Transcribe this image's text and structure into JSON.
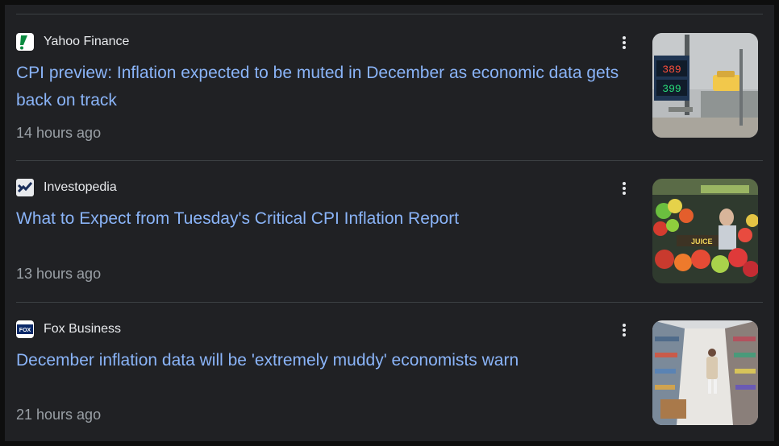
{
  "articles": [
    {
      "source": "Yahoo Finance",
      "favicon": "yahoo-finance-favicon",
      "headline": "CPI preview: Inflation expected to be muted in December as economic data gets back on track",
      "time": "14 hours ago",
      "image": "gas-station-price-sign-image",
      "gas_prices": [
        "389",
        "399"
      ]
    },
    {
      "source": "Investopedia",
      "favicon": "investopedia-favicon",
      "headline": "What to Expect from Tuesday's Critical CPI Inflation Report",
      "time": "13 hours ago",
      "image": "produce-market-image",
      "sign_text": "JUICE"
    },
    {
      "source": "Fox Business",
      "favicon": "fox-business-favicon",
      "headline": "December inflation data will be 'extremely muddy' economists warn",
      "time": "21 hours ago",
      "image": "grocery-aisle-shopper-image",
      "favicon_text": "FOX"
    }
  ],
  "menu_icon": "more-vert-icon",
  "colors": {
    "background": "#202124",
    "headline": "#8ab4f8",
    "source": "#e8eaed",
    "time": "#9aa0a6",
    "divider": "#3c4043"
  }
}
